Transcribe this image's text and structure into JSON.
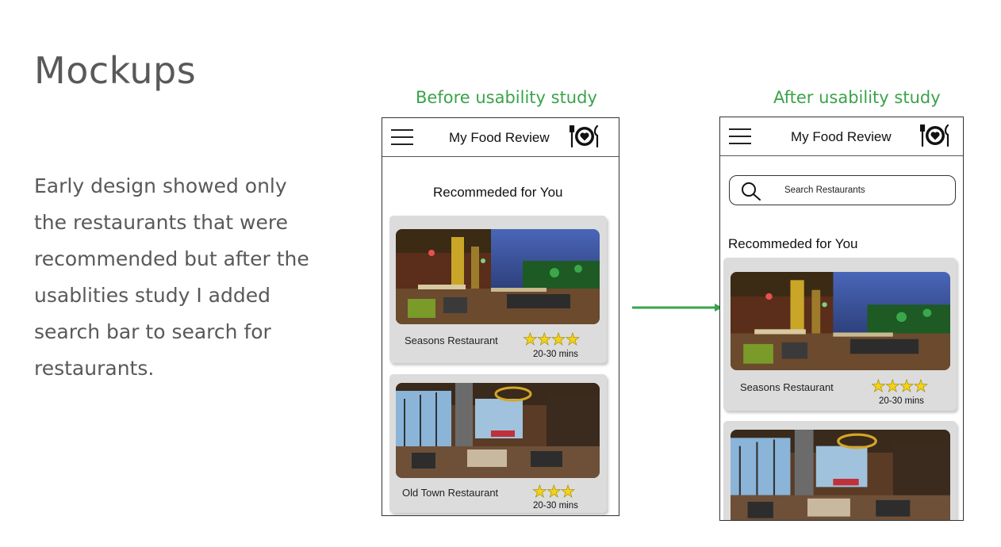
{
  "slide": {
    "title": "Mockups",
    "body_lines": [
      "Early design showed only",
      "the restaurants that were",
      "recommended but after the",
      "usablities study I added",
      "search bar to search for",
      "restaurants."
    ]
  },
  "before": {
    "caption": "Before usability study",
    "app_title": "My Food Review",
    "section_title": "Recommeded for You",
    "cards": [
      {
        "name": "Seasons Restaurant",
        "rating": 4,
        "stars": "★★★★",
        "eta": "20-30 mins",
        "image": "rooftop-dining-photo"
      },
      {
        "name": "Old Town Restaurant",
        "rating": 3,
        "stars": "★★★",
        "eta": "20-30 mins",
        "image": "indoor-dining-photo"
      }
    ]
  },
  "after": {
    "caption": "After usability study",
    "app_title": "My Food Review",
    "search_placeholder": "Search Restaurants",
    "section_title": "Recommeded for You",
    "cards": [
      {
        "name": "Seasons Restaurant",
        "rating": 4,
        "stars": "★★★★",
        "eta": "20-30 mins",
        "image": "rooftop-dining-photo"
      },
      {
        "image": "indoor-dining-photo"
      }
    ]
  },
  "colors": {
    "caption_green": "#3aa34a",
    "body_text": "#595959",
    "card_bg": "#dcdcdc",
    "star_yellow": "#f4d218"
  },
  "icons": [
    "hamburger-menu-icon",
    "plate-heart-logo-icon",
    "search-icon",
    "arrow-right-icon",
    "star-icon"
  ]
}
